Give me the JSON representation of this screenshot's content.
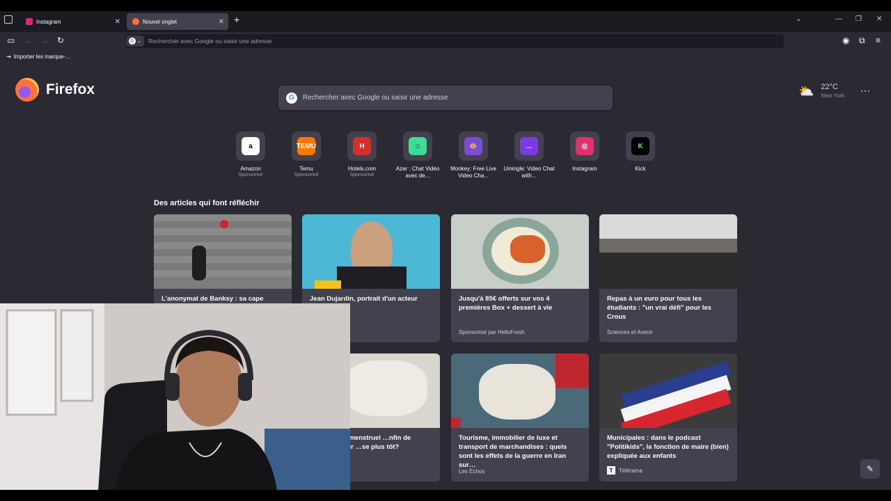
{
  "tabs": [
    {
      "label": "Instagram",
      "favicon_color": "#d62976"
    },
    {
      "label": "Nouvel onglet",
      "favicon_color": "#ff7139"
    }
  ],
  "urlbar": {
    "placeholder": "Rechercher avec Google ou saisir une adresse"
  },
  "bookmarks": [
    {
      "label": "Importer les marque-…"
    }
  ],
  "brand": {
    "name": "Firefox"
  },
  "search": {
    "placeholder": "Rechercher avec Google ou saisir une adresse"
  },
  "weather": {
    "temp": "22°C",
    "city": "New York"
  },
  "top_sites": [
    {
      "name": "Amazon",
      "sponsored": "Sponsorisé",
      "icon": "amazon-icon",
      "bg": "#ffffff",
      "fg": "#000000",
      "glyph": "a"
    },
    {
      "name": "Temu",
      "sponsored": "Sponsorisé",
      "icon": "temu-icon",
      "bg": "#fb7701",
      "fg": "#ffffff",
      "glyph": "TEMU"
    },
    {
      "name": "Hotels.com",
      "sponsored": "Sponsorisé",
      "icon": "hotels-icon",
      "bg": "#d32f2f",
      "fg": "#ffffff",
      "glyph": "H"
    },
    {
      "name": "Azar : Chat Vidéo avec de...",
      "sponsored": "",
      "icon": "azar-icon",
      "bg": "#3ddc97",
      "fg": "#0b3d2c",
      "glyph": "☺"
    },
    {
      "name": "Monkey: Free Live Video Cha...",
      "sponsored": "",
      "icon": "monkey-icon",
      "bg": "#7b4bd6",
      "fg": "#f5c27a",
      "glyph": "🐵"
    },
    {
      "name": "Umingle: Video Chat with...",
      "sponsored": "",
      "icon": "umingle-icon",
      "bg": "#7a3ce0",
      "fg": "#ffffff",
      "glyph": "…"
    },
    {
      "name": "Instagram",
      "sponsored": "",
      "icon": "instagram-icon",
      "bg": "#e1306c",
      "fg": "#ffffff",
      "glyph": "◎"
    },
    {
      "name": "Kick",
      "sponsored": "",
      "icon": "kick-icon",
      "bg": "#000000",
      "fg": "#53fc18",
      "glyph": "K"
    }
  ],
  "section_title": "Des articles qui font réfléchir",
  "articles": [
    {
      "title": "L'anonymat de Banksy : sa cape",
      "source": "",
      "img": "#7d7d7d"
    },
    {
      "title": "Jean Dujardin, portrait d'un acteur",
      "source": "",
      "img": "#4db8d6"
    },
    {
      "title": "Jusqu'à 85€ offerts sur vos 4 premières Box + dessert à vie",
      "source": "Sponsorisé par HelloFresh",
      "img": "#c8cfc9"
    },
    {
      "title": "Repas à un euro pour tous les étudiants : \"un vrai défi\" pour les Crous",
      "source": "Sciences et Avenir",
      "img": "#6f6a66"
    },
    {
      "title": "…e du sang menstruel …nfin de diagnostiquer …se plus tôt?",
      "source": "…ce",
      "img": "#d9d6d0"
    },
    {
      "title": "Tourisme, immobilier de luxe et transport de marchandises : quels sont les effets de la guerre en Iran sur…",
      "source": "Les Echos",
      "img": "#4a6a7a"
    },
    {
      "title": "Municipales : dans le podcast \"Politikids\", la fonction de maire (bien) expliquée aux enfants",
      "source": "Télérama",
      "img": "#3b3b3b"
    }
  ]
}
